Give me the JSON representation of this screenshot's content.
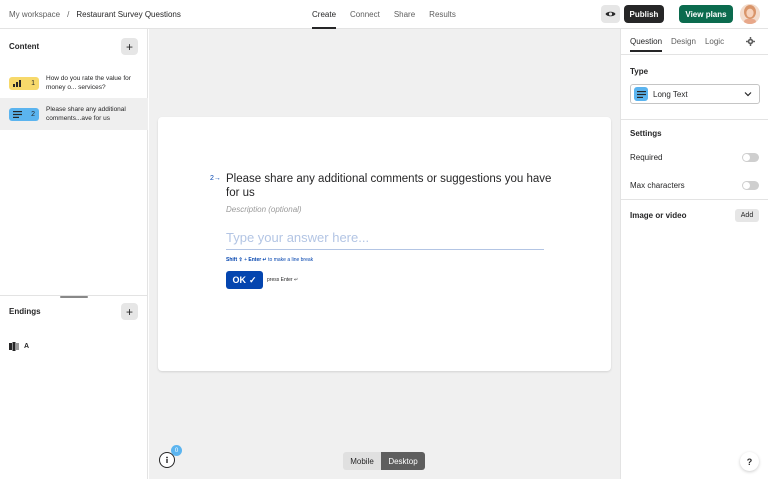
{
  "header": {
    "workspace": "My workspace",
    "separator": "/",
    "form_name": "Restaurant Survey Questions",
    "tabs": [
      {
        "label": "Create",
        "active": true
      },
      {
        "label": "Connect",
        "active": false
      },
      {
        "label": "Share",
        "active": false
      },
      {
        "label": "Results",
        "active": false
      }
    ],
    "publish_label": "Publish",
    "view_plans_label": "View plans",
    "preview_icon": "eye-icon"
  },
  "sidebar": {
    "content_title": "Content",
    "questions": [
      {
        "number": "1",
        "text": "How do you rate the value for money o... services?",
        "icon": "rating-bars-icon",
        "color": "#f7d96b"
      },
      {
        "number": "2",
        "text": "Please share any additional comments...ave for us",
        "icon": "long-text-icon",
        "color": "#5bb4ef",
        "selected": true
      }
    ],
    "endings_title": "Endings",
    "ending_label": "A"
  },
  "canvas": {
    "question_number": "2",
    "question_title": "Please share any additional comments or suggestions you have for us",
    "description_placeholder": "Description (optional)",
    "answer_placeholder": "Type your answer here...",
    "hint_shift": "Shift ⇧",
    "hint_plus": " + ",
    "hint_enter": "Enter ↵",
    "hint_text": " to make a line break",
    "ok_label": "OK",
    "press_enter": "press Enter ↵",
    "help_count": "0",
    "view_toggle": {
      "mobile": "Mobile",
      "desktop": "Desktop",
      "active": "Desktop"
    }
  },
  "panel": {
    "tabs": [
      {
        "label": "Question",
        "active": true
      },
      {
        "label": "Design",
        "active": false
      },
      {
        "label": "Logic",
        "active": false
      }
    ],
    "type_title": "Type",
    "type_value": "Long Text",
    "settings_title": "Settings",
    "required_label": "Required",
    "required_on": false,
    "max_chars_label": "Max characters",
    "max_chars_on": false,
    "media_label": "Image or video",
    "add_label": "Add",
    "help_label": "?"
  },
  "colors": {
    "accent": "#0445af",
    "publish_bg": "#262627",
    "view_plans_bg": "#0b6b4e",
    "long_text_icon": "#5bb4ef",
    "rating_icon": "#f7d96b"
  }
}
